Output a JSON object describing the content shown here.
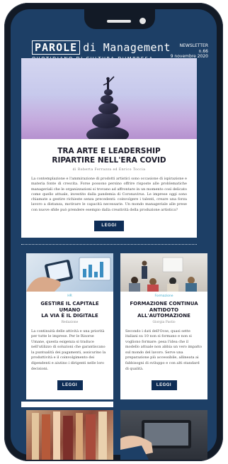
{
  "header": {
    "brand_primary": "PAROLE",
    "brand_secondary": "di Management",
    "tagline": "QUOTIDIANO DI CULTURA D'IMPRESA",
    "newsletter_label": "NEWSLETTER",
    "newsletter_number": "n.66",
    "newsletter_date": "9 novembre 2020"
  },
  "hero": {
    "title_line1": "TRA ARTE E LEADERSHIP",
    "title_line2": "RIPARTIRE NELL'ERA COVID",
    "authors": "di Roberta Ferrazza ed Enrico Toccia",
    "body": "La contemplazione e l'ammirazione di prodotti artistici sono occasione di ispirazione e materia fonte di crescita. Forse possono persino offrire risposte alle problematiche manageriali che le organizzazioni si trovano ad affrontare in un momento così delicato come quello attuale, investito dalla pandemia di Coronavirus. Le imprese oggi sono chiamate a gestire richieste senza precedenti: coinvolgere i talenti, creare una forza lavoro a distanza, motivare le capacità necessarie. Un mondo manageriale alle prese con nuove sfide può prendere esempio dalla creatività della produzione artistica?",
    "button": "LEGGI"
  },
  "cards": [
    {
      "category": "HR",
      "title_line1": "GESTIRE IL CAPITALE UMANO",
      "title_line2": "LA VIA È IL DIGITALE",
      "author": "Redazione",
      "body": "La continuità delle attività e una priorità per tutte le imprese. Per le Risorse Umane, questa esigenza si traduce nell'utilizzo di soluzioni che garantiscano la puntualità dei pagamenti, assicurino la produttività e il coinvolgimento dei dipendenti e aiutino i dirigenti nelle loro decisioni.",
      "button": "LEGGI"
    },
    {
      "category": "Formazione",
      "title_line1": "FORMAZIONE CONTINUA",
      "title_line2": "ANTIDOTO",
      "title_line3": "ALL'AUTOMAZIONE",
      "author": "Giorgia Pastio",
      "body": "Secondo i dati dell'Ocse, quasi sette italiani su 10 non si formano e non si vogliono formare: pesa l'idea che il modello attuale non abbia un vero impatto sul mondo del lavoro. Serve una preparazione più accessibile, allineata ai fabbisogni di sviluppo e con alti standard di qualità.",
      "button": "LEGGI"
    }
  ],
  "colors": {
    "screen_bg": "#1d3f66",
    "button_bg": "#0e2d56",
    "category_accent": "#39a9c9"
  }
}
